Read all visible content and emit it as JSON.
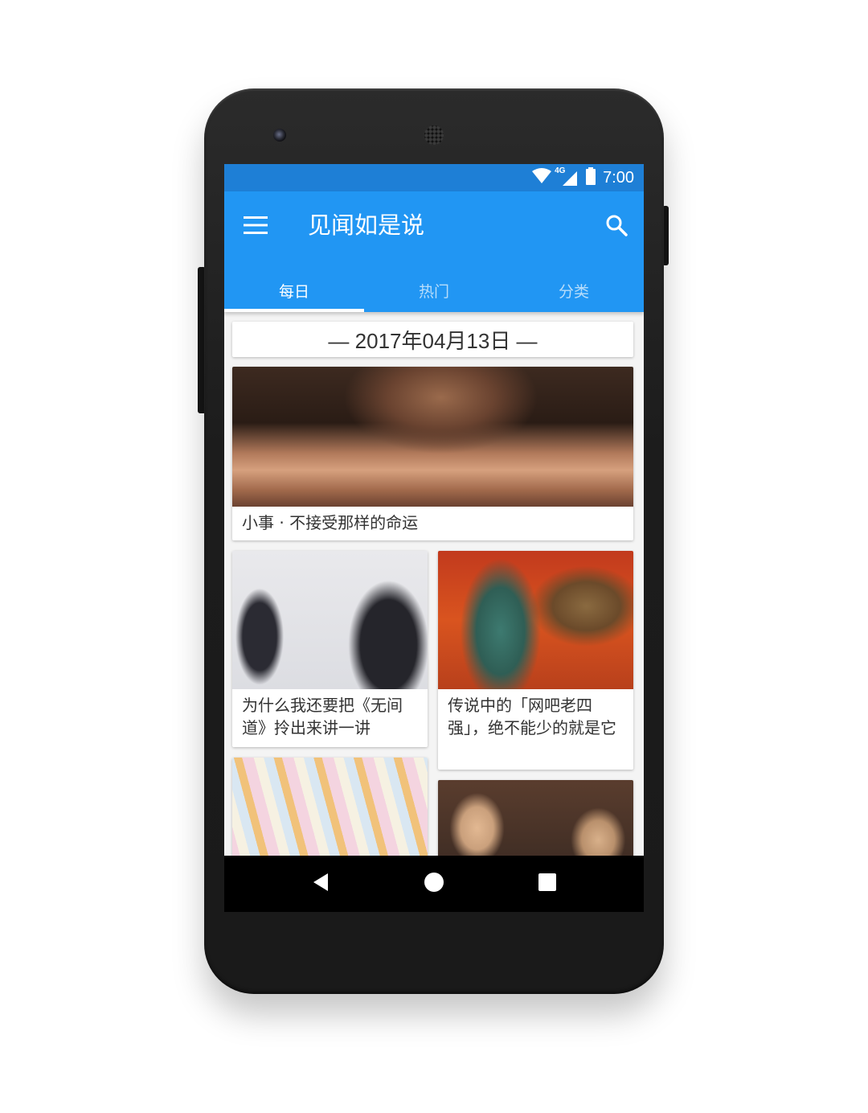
{
  "status_bar": {
    "time": "7:00",
    "network_label": "4G",
    "icons": [
      "wifi-icon",
      "cellular-signal-icon",
      "battery-icon"
    ]
  },
  "app_bar": {
    "title": "见闻如是说",
    "menu_icon": "hamburger-menu-icon",
    "search_icon": "search-icon",
    "color": "#2196f3",
    "status_color": "#1e7fd6"
  },
  "tabs": [
    {
      "label": "每日",
      "active": true
    },
    {
      "label": "热门",
      "active": false
    },
    {
      "label": "分类",
      "active": false
    }
  ],
  "feed": {
    "date_header": "— 2017年04月13日 —",
    "stories": [
      {
        "title": "小事 · 不接受那样的命运",
        "image": "photo"
      },
      {
        "title": "为什么我还要把《无间道》拎出来讲一讲",
        "image": "photo"
      },
      {
        "title": "传说中的「网吧老四强」，绝不能少的就是它",
        "image": "photo"
      },
      {
        "title": "",
        "image": "photo"
      },
      {
        "title": "",
        "image": "photo"
      }
    ]
  },
  "nav_bar": {
    "buttons": [
      "back-icon",
      "home-icon",
      "recents-icon"
    ]
  }
}
